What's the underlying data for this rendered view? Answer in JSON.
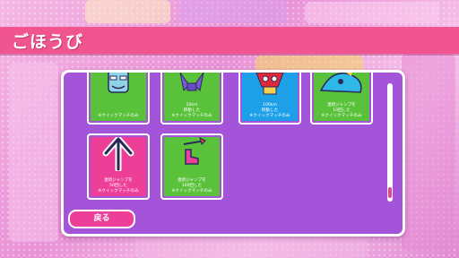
{
  "header": {
    "title": "ごほうび"
  },
  "rewards": [
    {
      "name": "reward-card-1",
      "color": "#59c23a",
      "lines": [
        "",
        "",
        "※クイックマッチのみ"
      ]
    },
    {
      "name": "reward-card-2",
      "color": "#59c23a",
      "lines": [
        "10km",
        "移動した",
        "※クイックマッチのみ"
      ]
    },
    {
      "name": "reward-card-3",
      "color": "#1ea0e8",
      "lines": [
        "100km",
        "移動した",
        "※クイックマッチのみ"
      ]
    },
    {
      "name": "reward-card-4",
      "color": "#59c23a",
      "lines": [
        "連続ジャンプを",
        "10回した",
        "※クイックマッチのみ"
      ]
    },
    {
      "name": "reward-card-5",
      "color": "#ee3f98",
      "lines": [
        "連続ジャンプを",
        "50回した",
        "※クイックマッチのみ"
      ]
    },
    {
      "name": "reward-card-6",
      "color": "#59c23a",
      "lines": [
        "連続ジャンプを",
        "100回した",
        "※クイックマッチのみ"
      ]
    }
  ],
  "back_label": "戻る"
}
